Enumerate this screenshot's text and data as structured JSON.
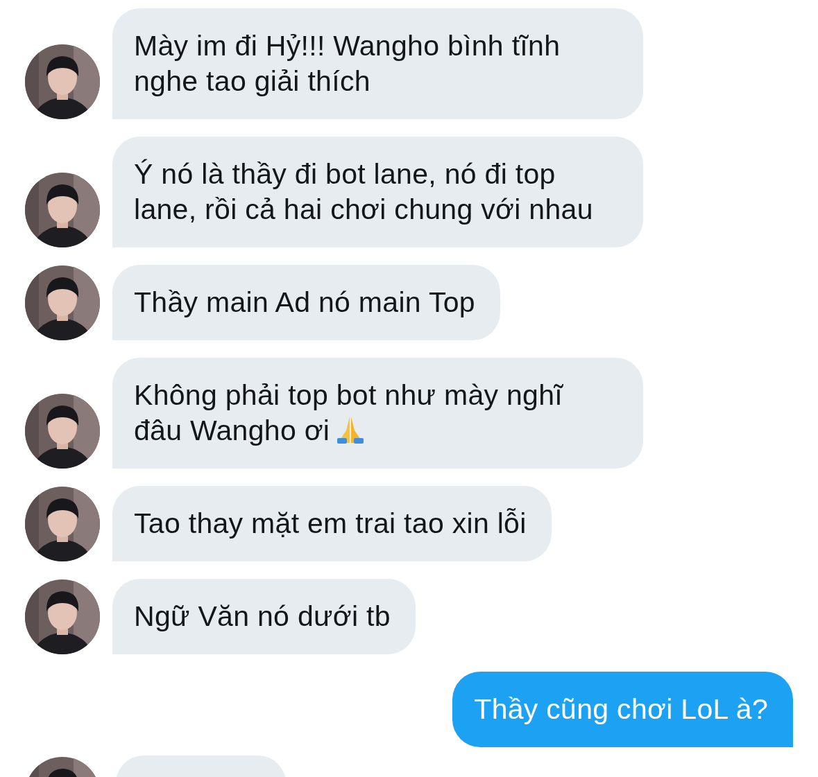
{
  "messages": [
    {
      "kind": "incoming",
      "text": "Mày im đi Hỷ!!! Wangho bình tĩnh\nnghe tao giải thích"
    },
    {
      "kind": "incoming",
      "text": "Ý nó là thầy đi bot lane, nó đi top\nlane, rồi cả hai chơi chung với nhau"
    },
    {
      "kind": "incoming",
      "text": "Thầy main Ad nó main Top"
    },
    {
      "kind": "incoming",
      "text": "Không phải top bot như mày nghĩ\nđâu Wangho ơi",
      "has_emoji": true
    },
    {
      "kind": "incoming",
      "text": "Tao thay mặt em trai tao xin lỗi"
    },
    {
      "kind": "incoming",
      "text": "Ngữ Văn nó dưới tb"
    },
    {
      "kind": "outgoing",
      "text": "Thầy cũng chơi LoL à?"
    },
    {
      "kind": "incoming_partial"
    }
  ]
}
